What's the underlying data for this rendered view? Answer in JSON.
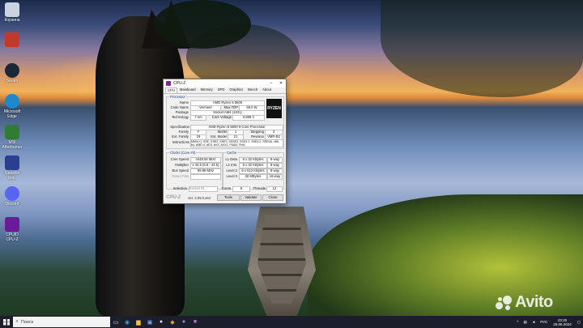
{
  "desktop_icons": [
    {
      "label": "Корзина",
      "color": "#c9d4e0"
    },
    {
      "label": "",
      "color": "#c0392b"
    },
    {
      "label": "Steam",
      "color": "#1b2838"
    },
    {
      "label": "Microsoft Edge",
      "color": "#1e88c8"
    },
    {
      "label": "MSI Afterburner",
      "color": "#2e7d32"
    },
    {
      "label": "Genshin Imp.",
      "color": "#2c3e90"
    },
    {
      "label": "Discord",
      "color": "#5865f2"
    },
    {
      "label": "CPUID CPU-Z",
      "color": "#6a1b9a"
    }
  ],
  "cpuz": {
    "title": "CPU-Z",
    "tabs": [
      "CPU",
      "Mainboard",
      "Memory",
      "SPD",
      "Graphics",
      "Bench",
      "About"
    ],
    "active_tab": "CPU",
    "processor": {
      "group": "Processor",
      "name_label": "Name",
      "name": "AMD Ryzen 5 5600",
      "codename_label": "Code Name",
      "codename": "Vermeer",
      "maxtdp_label": "Max TDP",
      "maxtdp": "65.0 W",
      "package_label": "Package",
      "package": "Socket AM4 (1331)",
      "technology_label": "Technology",
      "technology": "7 nm",
      "corevoltage_label": "Core Voltage",
      "corevoltage": "0.996 V",
      "spec_label": "Specification",
      "spec": "AMD Ryzen 5 5600 6-Core Processor",
      "family_label": "Family",
      "family": "F",
      "model_label": "Model",
      "model": "1",
      "stepping_label": "Stepping",
      "stepping": "2",
      "extfamily_label": "Ext. Family",
      "extfamily": "19",
      "extmodel_label": "Ext. Model",
      "extmodel": "21",
      "revision_label": "Revision",
      "revision": "VMR-B2",
      "instr_label": "Instructions",
      "instructions": "MMX(+), SSE, SSE2, SSE3, SSSE3, SSE4.1, SSE4.2, SSE4A, x86-64, AMD-V, AES, AVX, AVX2, FMA3, SHA",
      "logo": "RYZEN 5"
    },
    "clocks": {
      "group": "Clocks (Core #0)",
      "corespeed_label": "Core Speed",
      "corespeed": "4448.56 MHz",
      "multiplier_label": "Multiplier",
      "multiplier": "x 44.5 (5.5 - 44.5)",
      "busspeed_label": "Bus Speed",
      "busspeed": "99.98 MHz",
      "ratedfsb_label": "Rated FSB",
      "ratedfsb": ""
    },
    "cache": {
      "group": "Cache",
      "l1d_label": "L1 Data",
      "l1d": "6 x 32 KBytes",
      "l1d_way": "8-way",
      "l1i_label": "L1 Inst.",
      "l1i": "6 x 32 KBytes",
      "l1i_way": "8-way",
      "l2_label": "Level 2",
      "l2": "6 x 512 KBytes",
      "l2_way": "8-way",
      "l3_label": "Level 3",
      "l3": "32 MBytes",
      "l3_way": "16-way"
    },
    "selection_label": "Selection",
    "selection": "Socket #1",
    "cores_label": "Cores",
    "cores": "6",
    "threads_label": "Threads",
    "threads": "12",
    "brand": "CPU-Z",
    "version": "Ver. 2.09.0.x64",
    "tools": "Tools",
    "validate": "Validate",
    "close": "Close"
  },
  "taskbar": {
    "search_placeholder": "Поиск",
    "lang": "РУС",
    "time": "23:20",
    "date": "26.05.2024"
  },
  "watermark": "Avito"
}
